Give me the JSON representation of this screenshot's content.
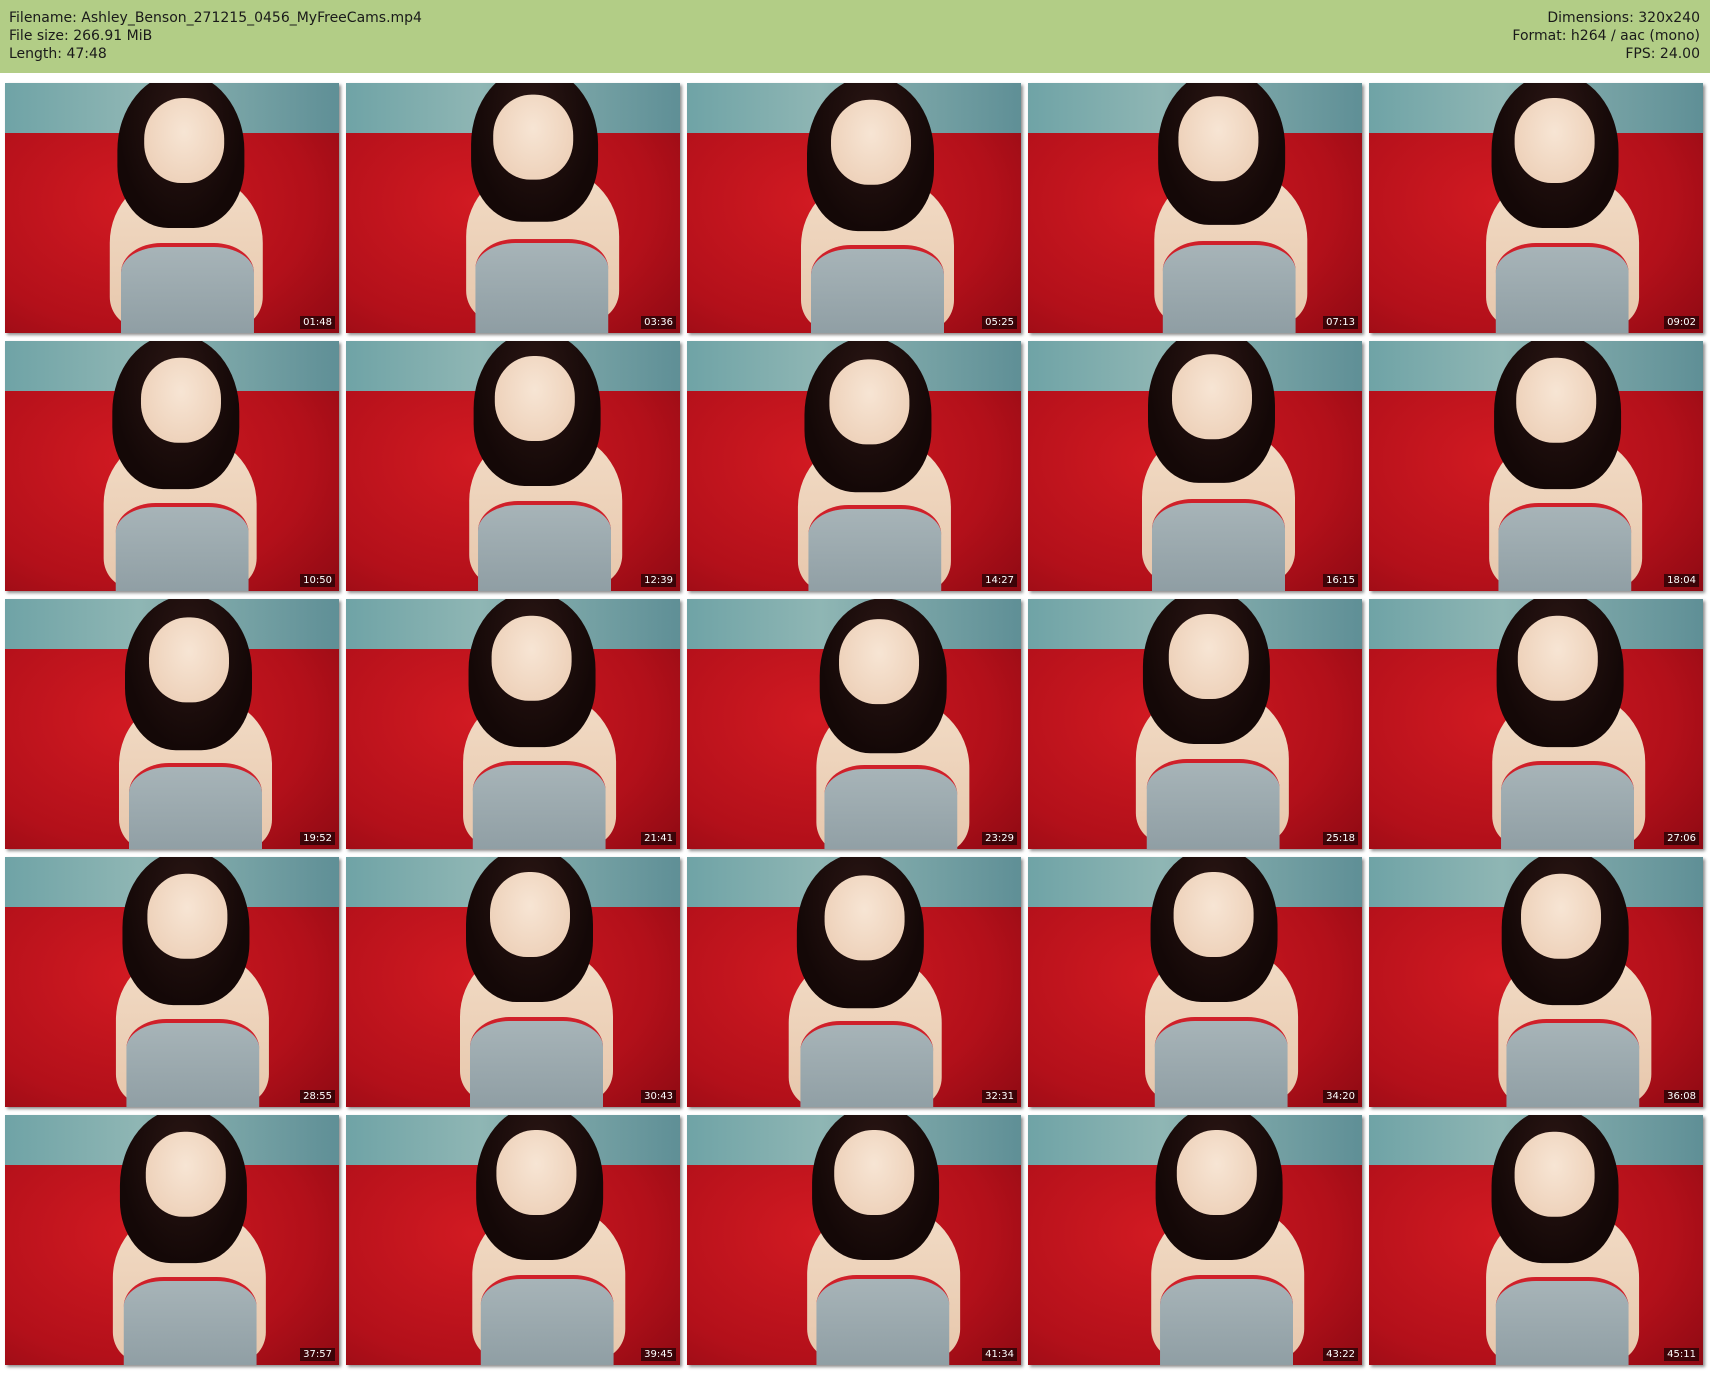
{
  "header": {
    "left": [
      "Filename: Ashley_Benson_271215_0456_MyFreeCams.mp4",
      "File size: 266.91 MiB",
      "Length: 47:48"
    ],
    "right": [
      "Dimensions: 320x240",
      "Format: h264 / aac (mono)",
      "FPS: 24.00"
    ]
  },
  "thumbnails": [
    {
      "time": "01:48"
    },
    {
      "time": "03:36"
    },
    {
      "time": "05:25"
    },
    {
      "time": "07:13"
    },
    {
      "time": "09:02"
    },
    {
      "time": "10:50"
    },
    {
      "time": "12:39"
    },
    {
      "time": "14:27"
    },
    {
      "time": "16:15"
    },
    {
      "time": "18:04"
    },
    {
      "time": "19:52"
    },
    {
      "time": "21:41"
    },
    {
      "time": "23:29"
    },
    {
      "time": "25:18"
    },
    {
      "time": "27:06"
    },
    {
      "time": "28:55"
    },
    {
      "time": "30:43"
    },
    {
      "time": "32:31"
    },
    {
      "time": "34:20"
    },
    {
      "time": "36:08"
    },
    {
      "time": "37:57"
    },
    {
      "time": "39:45"
    },
    {
      "time": "41:34"
    },
    {
      "time": "43:22"
    },
    {
      "time": "45:11"
    }
  ],
  "colors": {
    "header_bg": "#b2cd86",
    "sofa_red": "#b5121b",
    "wall_teal": "#6fa3a6"
  }
}
